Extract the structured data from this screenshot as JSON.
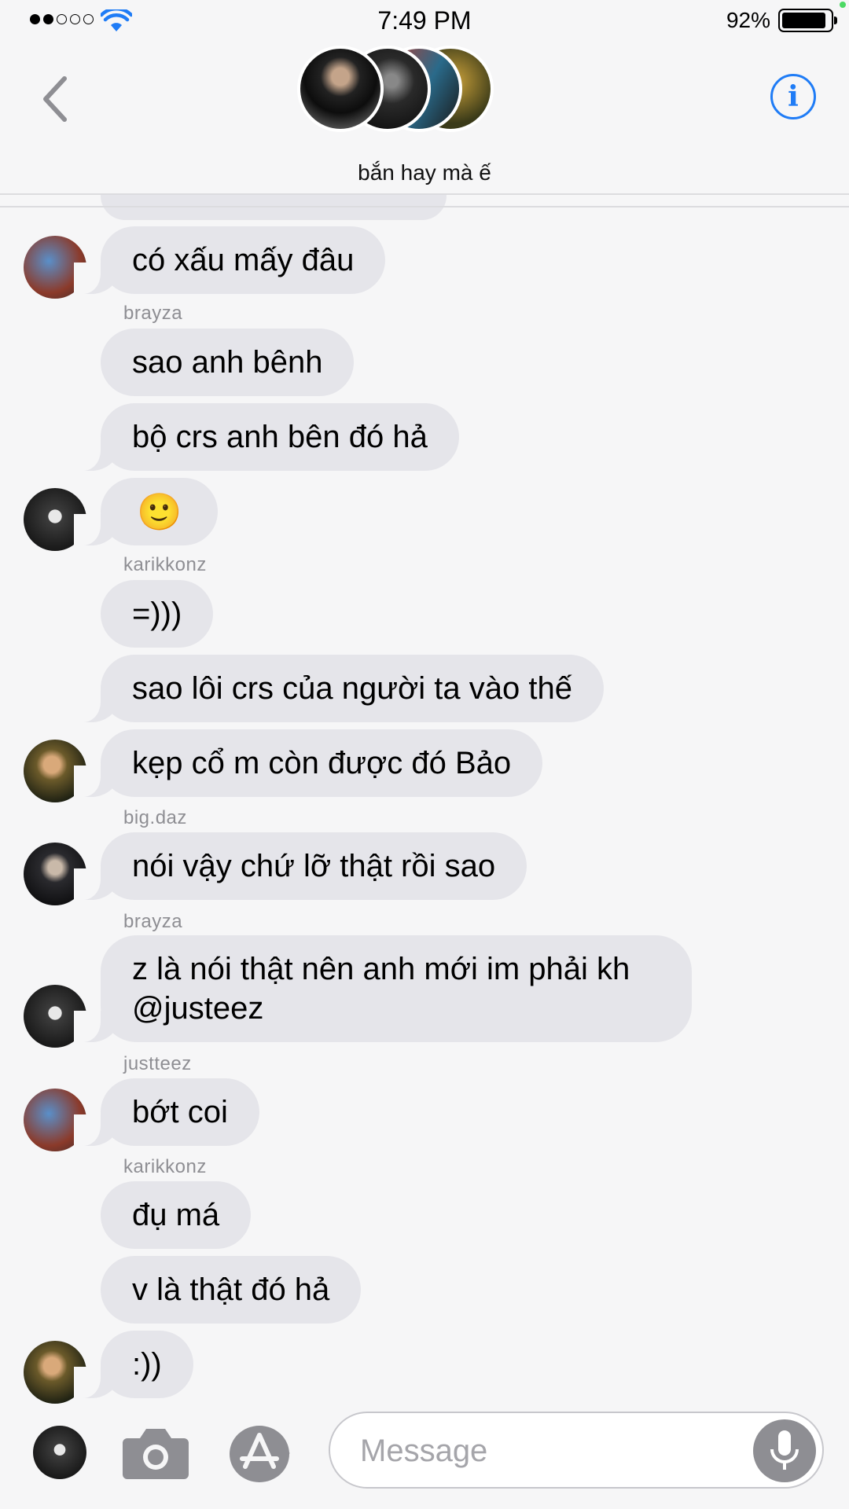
{
  "status": {
    "time": "7:49 PM",
    "battery": "92%"
  },
  "header": {
    "group_name": "bắn hay mà ế"
  },
  "messages": [
    {
      "text": "có xấu mấy đâu"
    },
    {
      "sender": "brayza"
    },
    {
      "text": "sao anh bênh"
    },
    {
      "text": "bộ crs anh bên đó hả"
    },
    {
      "text": "🙂"
    },
    {
      "sender": "karikkonz"
    },
    {
      "text": "=)))"
    },
    {
      "text": "sao lôi crs của người ta vào thế"
    },
    {
      "text": "kẹp cổ m còn được đó Bảo"
    },
    {
      "sender": "big.daz"
    },
    {
      "text": "nói vậy chứ lỡ thật rồi sao"
    },
    {
      "sender": "brayza"
    },
    {
      "text_line1": "z là nói thật nên anh mới im phải kh",
      "text_line2": "@justeez"
    },
    {
      "sender": "justteez"
    },
    {
      "text": "bớt coi"
    },
    {
      "sender": "karikkonz"
    },
    {
      "text": "đụ má"
    },
    {
      "text": "v là thật đó hả"
    },
    {
      "text": ":))"
    }
  ],
  "composer": {
    "placeholder": "Message"
  },
  "colors": {
    "accent": "#1f7cf6",
    "bubble": "#e5e5ea",
    "sender": "#8e8e93"
  },
  "icons": [
    "back-chevron-icon",
    "info-icon",
    "wifi-icon",
    "camera-icon",
    "app-store-icon",
    "microphone-icon"
  ]
}
